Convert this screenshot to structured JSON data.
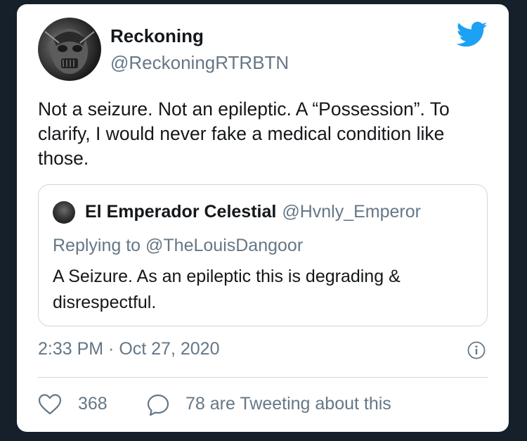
{
  "author": {
    "display_name": "Reckoning",
    "handle": "@ReckoningRTRBTN"
  },
  "tweet": {
    "text": "Not a seizure. Not an epileptic. A “Possession”. To clarify, I would never fake a medical condition like those."
  },
  "quoted_tweet": {
    "display_name": "El Emperador Celestial",
    "handle": "@Hvnly_Emperor",
    "replying_to": "Replying to @TheLouisDangoor",
    "text": "A Seizure. As an epileptic this is degrading & disrespectful."
  },
  "meta": {
    "timestamp": "2:33 PM · Oct 27, 2020"
  },
  "actions": {
    "likes": "368",
    "replies_label": "78 are Tweeting about this"
  },
  "colors": {
    "brand_blue": "#1da1f2",
    "text_primary": "#14171a",
    "text_secondary": "#657786",
    "border": "#ccd6dd",
    "page_background": "#15202b"
  },
  "icons": {
    "logo": "twitter-bird-icon",
    "info": "info-icon",
    "like": "heart-icon",
    "reply": "speech-bubble-icon"
  }
}
